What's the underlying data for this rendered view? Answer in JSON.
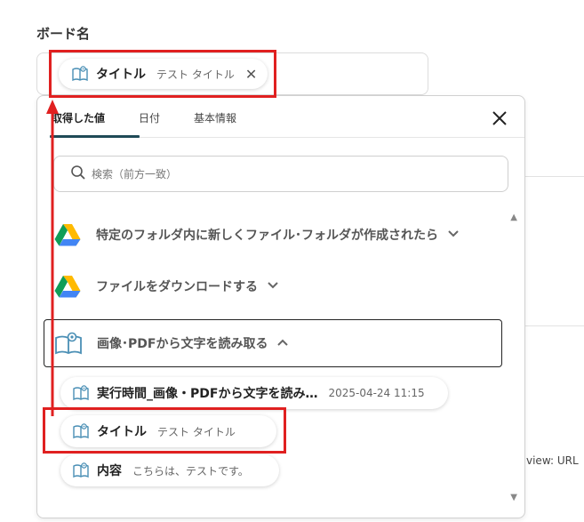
{
  "board_label": "ボード名",
  "field_chip": {
    "name": "タイトル",
    "value": "テスト タイトル"
  },
  "panel": {
    "tabs": [
      {
        "label": "取得した値",
        "active": true
      },
      {
        "label": "日付",
        "active": false
      },
      {
        "label": "基本情報",
        "active": false
      }
    ],
    "search_placeholder": "検索（前方一致）",
    "sections": [
      {
        "label": "特定のフォルダ内に新しくファイル･フォルダが作成されたら",
        "icon": "google-drive-icon",
        "expanded": false
      },
      {
        "label": "ファイルをダウンロードする",
        "icon": "google-drive-icon",
        "expanded": false
      },
      {
        "label": "画像･PDFから文字を読み取る",
        "icon": "ocr-book-icon",
        "expanded": true
      }
    ],
    "outputs": [
      {
        "name": "実行時間_画像・PDFから文字を読み…",
        "value": "2025-04-24 11:15"
      },
      {
        "name": "タイトル",
        "value": "テスト タイトル"
      },
      {
        "name": "内容",
        "value": "こちらは、テストです。"
      }
    ]
  },
  "background_text": "view: URL",
  "colors": {
    "annotation_red": "#e02020",
    "tab_underline": "#1f4a57",
    "icon_blue": "#4a8fb5"
  }
}
